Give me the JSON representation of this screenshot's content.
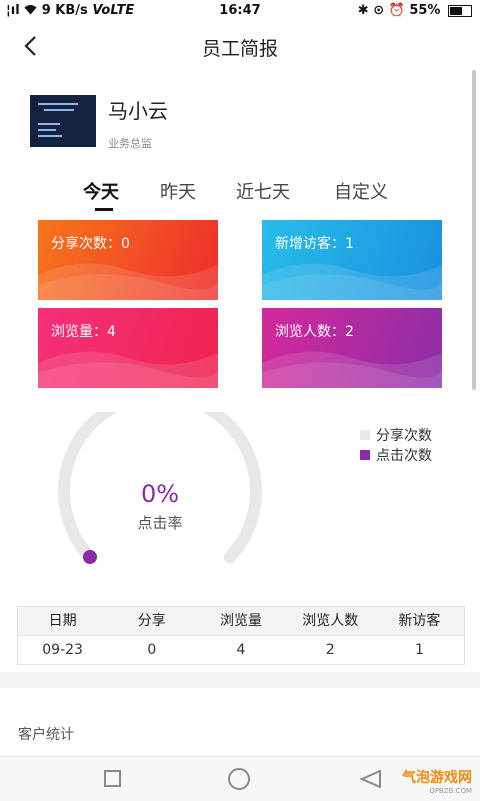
{
  "status_bar": {
    "signal": "¦ıl",
    "network_speed": "9 KB/s",
    "volte": "VoLTE",
    "time": "16:47",
    "battery": "55%"
  },
  "header": {
    "title": "员工简报"
  },
  "profile": {
    "name": "马小云",
    "role": "业务总监"
  },
  "tabs": [
    {
      "label": "今天",
      "active": true
    },
    {
      "label": "昨天",
      "active": false
    },
    {
      "label": "近七天",
      "active": false
    },
    {
      "label": "自定义",
      "active": false
    }
  ],
  "cards": {
    "shares": "分享次数：0",
    "new_visitors": "新增访客：1",
    "views": "浏览量：4",
    "viewers": "浏览人数：2"
  },
  "gauge": {
    "percent_text": "0%",
    "label": "点击率",
    "value": 0
  },
  "legend": [
    {
      "label": "分享次数",
      "color": "#e8e8e8"
    },
    {
      "label": "点击次数",
      "color": "#8d2aa6"
    }
  ],
  "table": {
    "headers": [
      "日期",
      "分享",
      "浏览量",
      "浏览人数",
      "新访客"
    ],
    "rows": [
      [
        "09-23",
        "0",
        "4",
        "2",
        "1"
      ]
    ]
  },
  "section": {
    "customer_stats": "客户统计"
  },
  "watermark": {
    "text": "气泡游戏网",
    "sub": "QPBZB.COM"
  },
  "colors": {
    "accent_purple": "#8d2aa6",
    "card_orange": [
      "#f7761b",
      "#ee2d2d"
    ],
    "card_blue": [
      "#27bde8",
      "#1a8fe0"
    ],
    "card_pink": [
      "#f5307a",
      "#f0244f"
    ],
    "card_purple": [
      "#d5299b",
      "#8a2ea8"
    ]
  }
}
